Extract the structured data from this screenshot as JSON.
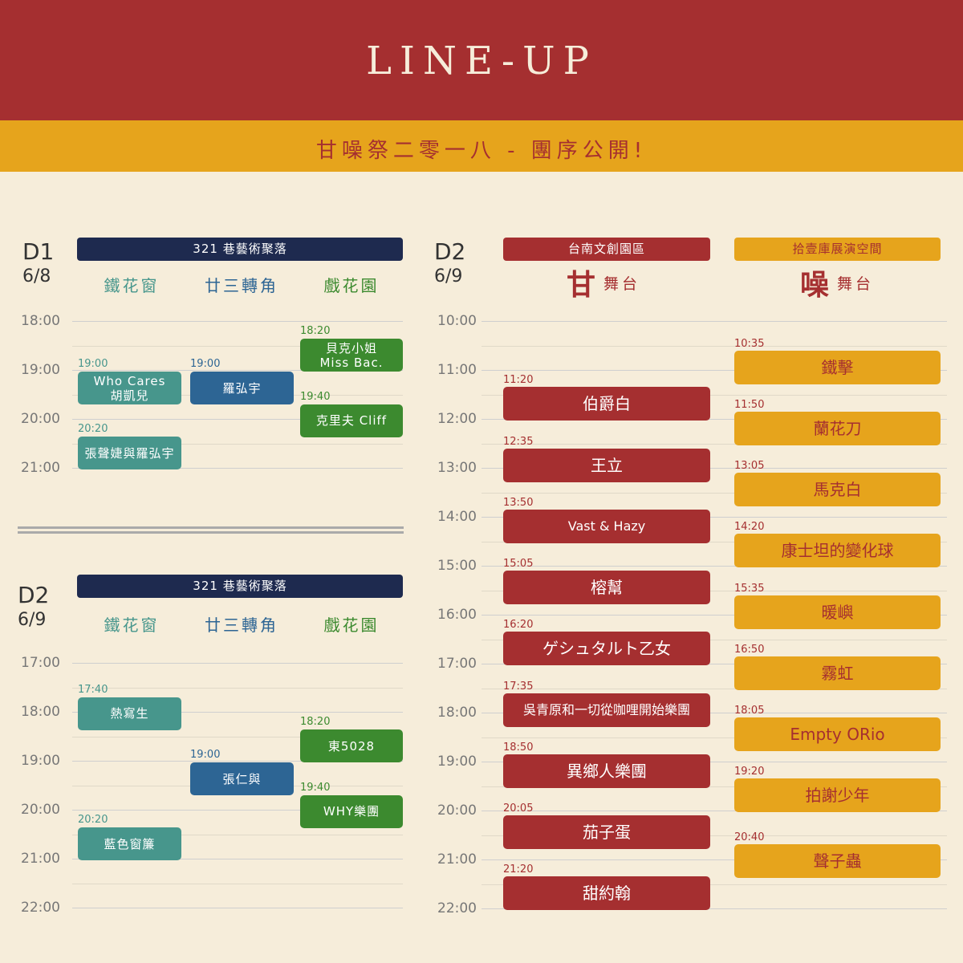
{
  "header": {
    "title": "LINE-UP",
    "subtitle": "甘噪祭二零一八 - 團序公開!"
  },
  "colors": {
    "red": "#a52f30",
    "yellow": "#e6a41c",
    "navy": "#1e2a4f",
    "teal": "#47968c",
    "blue": "#2d6594",
    "green": "#3c8a2f"
  },
  "d1": {
    "day": "D1",
    "date": "6/8",
    "venue": "321 巷藝術聚落",
    "columns": [
      "鐵花窗",
      "廿三轉角",
      "戲花園"
    ],
    "times": [
      "18:00",
      "19:00",
      "20:00",
      "21:00"
    ],
    "slots": [
      {
        "time": "19:00",
        "lines": [
          "Who Cares",
          "胡凱兒"
        ],
        "col": 0
      },
      {
        "time": "20:20",
        "lines": [
          "張聲婕與羅弘宇"
        ],
        "col": 0
      },
      {
        "time": "19:00",
        "lines": [
          "羅弘宇"
        ],
        "col": 1
      },
      {
        "time": "18:20",
        "lines": [
          "貝克小姐",
          "Miss Bac."
        ],
        "col": 2
      },
      {
        "time": "19:40",
        "lines": [
          "克里夫 Cliff"
        ],
        "col": 2
      }
    ]
  },
  "d2_left": {
    "day": "D2",
    "date": "6/9",
    "venue": "321 巷藝術聚落",
    "columns": [
      "鐵花窗",
      "廿三轉角",
      "戲花園"
    ],
    "times": [
      "17:00",
      "18:00",
      "19:00",
      "20:00",
      "21:00",
      "22:00"
    ],
    "slots": [
      {
        "time": "17:40",
        "lines": [
          "熱寫生"
        ],
        "col": 0
      },
      {
        "time": "20:20",
        "lines": [
          "藍色窗簾"
        ],
        "col": 0
      },
      {
        "time": "19:00",
        "lines": [
          "張仁與"
        ],
        "col": 1
      },
      {
        "time": "18:20",
        "lines": [
          "東5028"
        ],
        "col": 2
      },
      {
        "time": "19:40",
        "lines": [
          "WHY樂團"
        ],
        "col": 2
      }
    ]
  },
  "d2_right": {
    "day": "D2",
    "date": "6/9",
    "venues": [
      "台南文創園區",
      "拾壹庫展演空間"
    ],
    "stages": [
      {
        "kanji": "甘",
        "label": "舞台"
      },
      {
        "kanji": "噪",
        "label": "舞台"
      }
    ],
    "times": [
      "10:00",
      "11:00",
      "12:00",
      "13:00",
      "14:00",
      "15:00",
      "16:00",
      "17:00",
      "18:00",
      "19:00",
      "20:00",
      "21:00",
      "22:00"
    ],
    "gan": [
      {
        "time": "11:20",
        "name": "伯爵白"
      },
      {
        "time": "12:35",
        "name": "王立"
      },
      {
        "time": "13:50",
        "name": "Vast & Hazy"
      },
      {
        "time": "15:05",
        "name": "榕幫"
      },
      {
        "time": "16:20",
        "name": "ゲシュタルト乙女"
      },
      {
        "time": "17:35",
        "name": "吳青原和一切從咖哩開始樂團"
      },
      {
        "time": "18:50",
        "name": "異鄉人樂團"
      },
      {
        "time": "20:05",
        "name": "茄子蛋"
      },
      {
        "time": "21:20",
        "name": "甜約翰"
      }
    ],
    "zao": [
      {
        "time": "10:35",
        "name": "鐵擊"
      },
      {
        "time": "11:50",
        "name": "蘭花刀"
      },
      {
        "time": "13:05",
        "name": "馬克白"
      },
      {
        "time": "14:20",
        "name": "康士坦的變化球"
      },
      {
        "time": "15:35",
        "name": "暖嶼"
      },
      {
        "time": "16:50",
        "name": "霧虹"
      },
      {
        "time": "18:05",
        "name": "Empty ORio"
      },
      {
        "time": "19:20",
        "name": "拍謝少年"
      },
      {
        "time": "20:40",
        "name": "聲子蟲"
      }
    ]
  }
}
